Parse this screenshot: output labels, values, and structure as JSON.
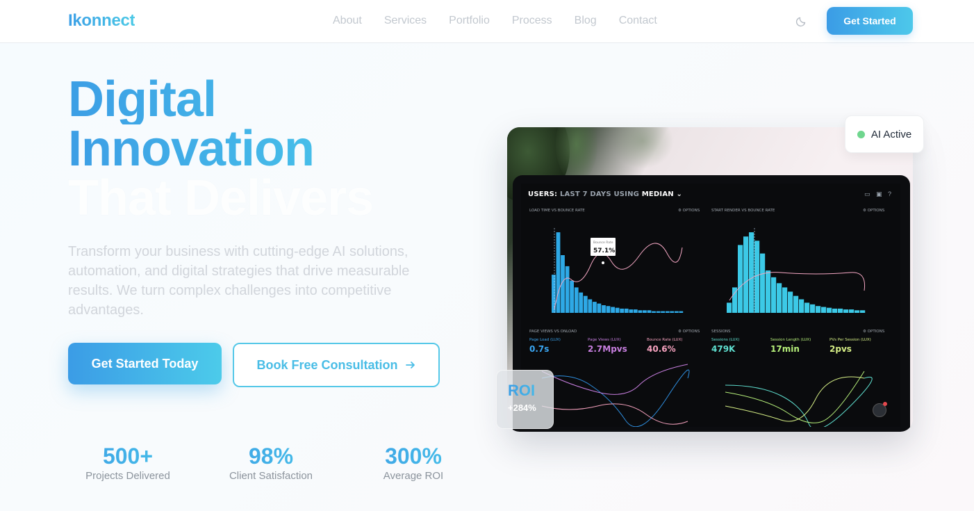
{
  "nav": {
    "logo": "Ikonnect",
    "links": [
      "About",
      "Services",
      "Portfolio",
      "Process",
      "Blog",
      "Contact"
    ],
    "theme_icon": "moon-icon",
    "cta_label": "Get Started"
  },
  "hero": {
    "title_line1": "Digital",
    "title_line2": "Innovation",
    "title_line3": "That Delivers",
    "description": "Transform your business with cutting-edge AI solutions, automation, and digital strategies that drive measurable results. We turn complex challenges into competitive advantages.",
    "primary_button": "Get Started Today",
    "secondary_button": "Book Free Consultation",
    "secondary_icon": "arrow-right-icon"
  },
  "stats": [
    {
      "value": "500+",
      "label": "Projects Delivered"
    },
    {
      "value": "98%",
      "label": "Client Satisfaction"
    },
    {
      "value": "300%",
      "label": "Average ROI"
    }
  ],
  "badges": {
    "ai_status": "AI Active",
    "ai_status_color": "#6fd68e",
    "roi_label": "ROI",
    "roi_value": "+284%"
  },
  "dashboard": {
    "title_prefix": "USERS:",
    "title_mid": "LAST 7 DAYS",
    "title_suffix": "USING",
    "title_end": "MEDIAN",
    "panels": {
      "p1": "LOAD TIME VS BOUNCE RATE",
      "p2": "START RENDER VS BOUNCE RATE",
      "p3": "PAGE VIEWS VS ONLOAD",
      "p4": "SESSIONS",
      "options": "⚙ OPTIONS"
    },
    "tooltip_label": "Bounce Rate",
    "tooltip_value": "57.1%",
    "metrics": [
      {
        "label": "Page Load (LUX)",
        "value": "0.7s",
        "color": "#3aa6f2"
      },
      {
        "label": "Page Views (LUX)",
        "value": "2.7Mpvs",
        "color": "#c87fe0"
      },
      {
        "label": "Bounce Rate (LUX)",
        "value": "40.6%",
        "color": "#f6a2bf"
      },
      {
        "label": "Sessions (LUX)",
        "value": "479K",
        "color": "#5fe0d0"
      },
      {
        "label": "Session Length (LUX)",
        "value": "17min",
        "color": "#b6f07a"
      },
      {
        "label": "PVs Per Session (LUX)",
        "value": "2pvs",
        "color": "#d6ef86"
      }
    ],
    "bars_left": [
      0.45,
      0.95,
      0.68,
      0.55,
      0.38,
      0.3,
      0.24,
      0.2,
      0.16,
      0.13,
      0.11,
      0.09,
      0.08,
      0.07,
      0.06,
      0.05,
      0.05,
      0.04,
      0.04,
      0.03,
      0.03,
      0.03,
      0.02,
      0.02,
      0.02,
      0.02,
      0.02,
      0.02,
      0.02
    ],
    "bars_right": [
      0.12,
      0.3,
      0.8,
      0.9,
      0.95,
      0.85,
      0.7,
      0.5,
      0.42,
      0.35,
      0.3,
      0.25,
      0.2,
      0.16,
      0.12,
      0.1,
      0.08,
      0.07,
      0.06,
      0.05,
      0.05,
      0.04,
      0.04,
      0.03,
      0.03
    ],
    "bar_color": "#2ea9e6",
    "bar_color_right": "#3cc9e6"
  }
}
